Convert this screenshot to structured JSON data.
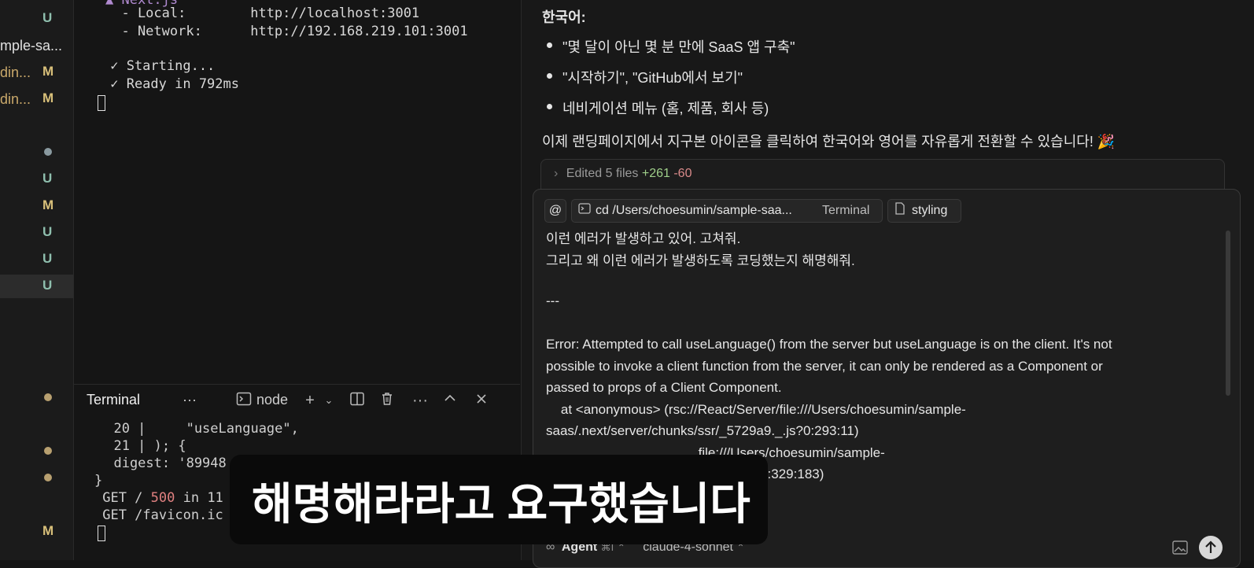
{
  "explorer": {
    "rows": [
      {
        "name": "",
        "badge": "U"
      },
      {
        "name": "mple-sa...",
        "badge": ""
      },
      {
        "name": "din...",
        "badge": "M"
      },
      {
        "name": "din...",
        "badge": "M"
      },
      {
        "name": "",
        "badge": "U"
      },
      {
        "name": "",
        "badge": "M"
      },
      {
        "name": "",
        "badge": "U"
      },
      {
        "name": "",
        "badge": "U"
      },
      {
        "name": "",
        "badge": "U"
      },
      {
        "name": "",
        "badge": "M"
      }
    ]
  },
  "terminal_top": {
    "line_local": "  - Local:        http://localhost:3001",
    "line_network": "  - Network:      http://192.168.219.101:3001",
    "line_starting": " ✓ Starting...",
    "line_ready": " ✓ Ready in 792ms"
  },
  "terminal_panel": {
    "tab_label": "Terminal",
    "more": "···",
    "shell_label": "node",
    "lines": [
      "  20 |     \"useLanguage\",",
      "  21 | ); {",
      "  digest: '89948",
      "}",
      " GET / 500 in 11",
      " GET /favicon.ic"
    ],
    "status_500": "500"
  },
  "chat": {
    "korean_heading": "한국어:",
    "bullets": [
      "\"몇 달이 아닌 몇 분 만에 SaaS 앱 구축\"",
      "\"시작하기\", \"GitHub에서 보기\"",
      "네비게이션 메뉴 (홈, 제품, 회사 등)"
    ],
    "summary": "이제 랜딩페이지에서 지구본 아이콘을 클릭하여 한국어와 영어를 자유롭게 전환할 수 있습니다! 🎉",
    "edited": {
      "label": "Edited 5 files",
      "plus": "+261",
      "minus": "-60"
    },
    "composer": {
      "at_symbol": "@",
      "chip_terminal_path": "cd /Users/choesumin/sample-saa...",
      "chip_terminal_type": "Terminal",
      "chip_styling": "styling",
      "message_lines": [
        "이런 에러가 발생하고 있어. 고쳐줘.",
        "그리고 왜 이런 에러가 발생하도록 코딩했는지 해명해줘.",
        "",
        "---",
        "",
        "Error: Attempted to call useLanguage() from the server but useLanguage is on the client. It's not",
        "possible to invoke a client function from the server, it can only be rendered as a Component or",
        "passed to props of a Client Component.",
        "    at <anonymous> (rsc://React/Server/file:///Users/choesumin/sample-",
        "saas/.next/server/chunks/ssr/_5729a9._.js?0:293:11)",
        "                                         file:///Users/choesumin/sample-",
        "                                         29a9._.js?1:329:183)"
      ],
      "agent_label": "Agent",
      "agent_shortcut": "⌘I",
      "model": "claude-4-sonnet"
    }
  },
  "caption": "해명해라라고 요구했습니다"
}
